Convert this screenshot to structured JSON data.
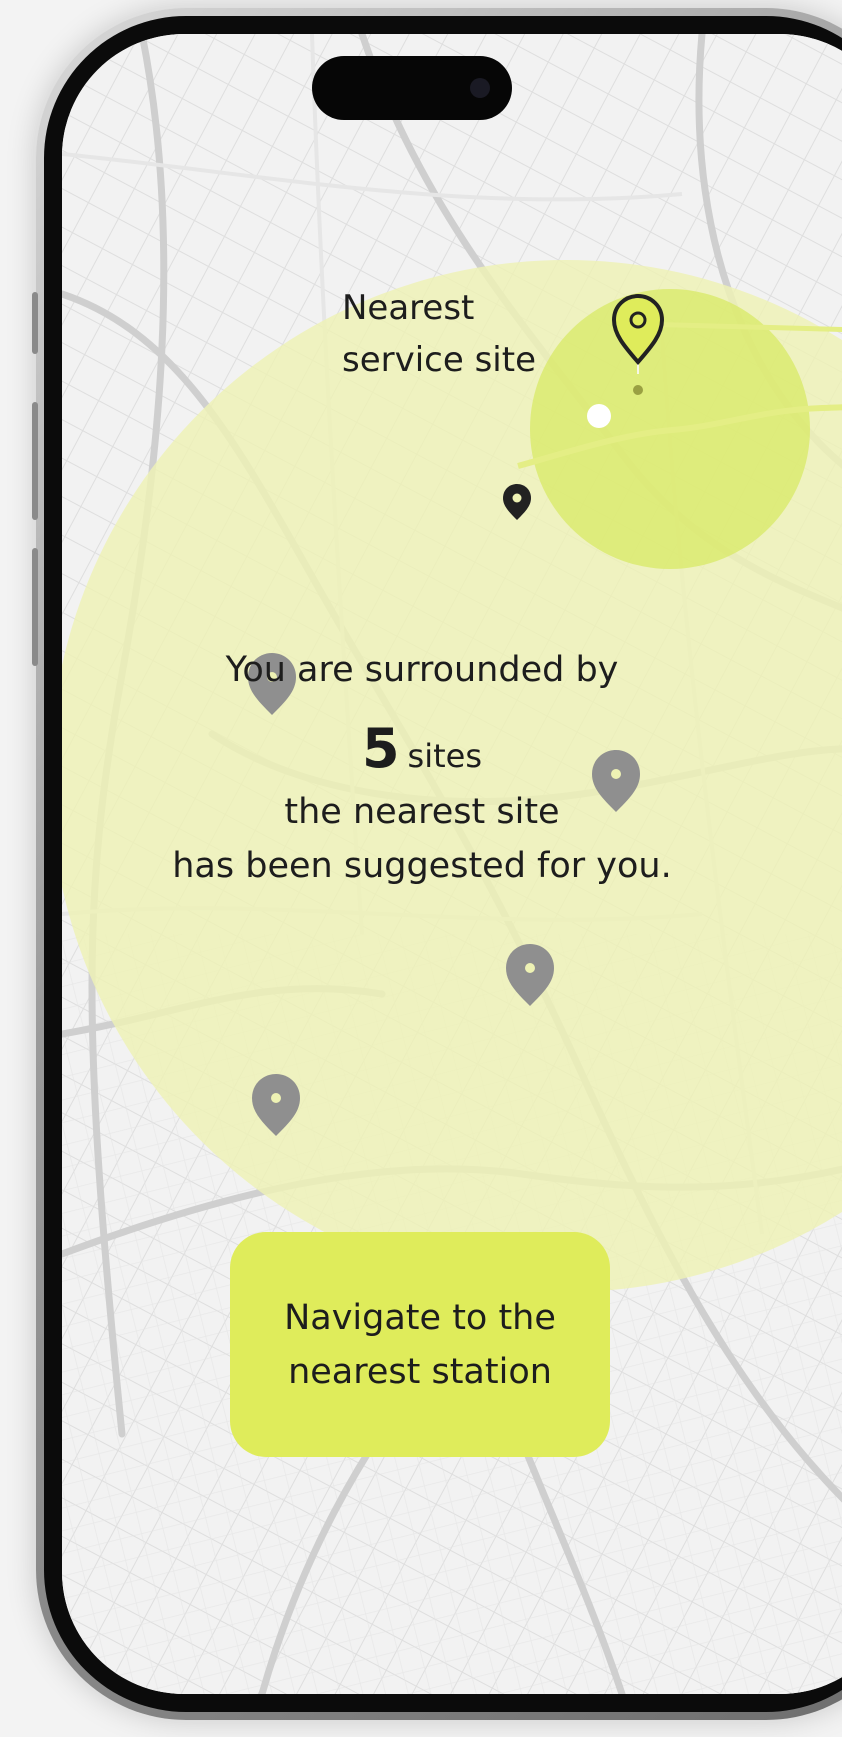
{
  "map": {
    "nearest_label_line1": "Nearest",
    "nearest_label_line2": "service site",
    "surround_text": "You are surrounded by",
    "site_count": "5",
    "site_unit": "sites",
    "nearest_line": "the nearest site",
    "suggested_line": "has been suggested for you.",
    "sites_total": 5
  },
  "cta": {
    "line1": "Navigate to the",
    "line2": "nearest station"
  },
  "colors": {
    "accent": "#dfec5b",
    "radius_fill": "#eef2b4",
    "nearest_zone": "#d9ea6a",
    "pin_gray": "#8f8f8f",
    "pin_dark": "#222222",
    "map_bg": "#f2f2f2",
    "road": "#d4d4d4"
  },
  "icons": {
    "selected_pin": "map-pin-outline-icon",
    "user_pin": "map-pin-dark-icon",
    "site_pin": "map-pin-gray-icon",
    "location_dot": "current-location-dot-icon"
  }
}
